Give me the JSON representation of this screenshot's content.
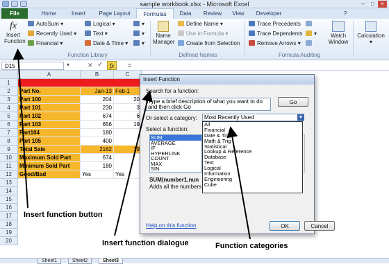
{
  "window": {
    "title": "sample workbook.xlsx - Microsoft Excel"
  },
  "tabs": [
    "File",
    "Home",
    "Insert",
    "Page Layout",
    "Formulas",
    "Data",
    "Review",
    "View",
    "Developer"
  ],
  "ribbon": {
    "insert_function": "Insert\nFunction",
    "fx": "fx",
    "library": {
      "autosum": "AutoSum",
      "recently_used": "Recently Used",
      "financial": "Financial",
      "logical": "Logical",
      "text": "Text",
      "date_time": "Date & Time",
      "group_label": "Function Library"
    },
    "defined_names": {
      "name_manager": "Name\nManager",
      "define_name": "Define Name",
      "use_in_formula": "Use in Formula",
      "create_from_selection": "Create from Selection",
      "group_label": "Defined Names"
    },
    "auditing": {
      "trace_precedents": "Trace Precedents",
      "trace_dependents": "Trace Dependents",
      "remove_arrows": "Remove Arrows",
      "watch_window": "Watch\nWindow",
      "group_label": "Formula Auditing"
    },
    "calculation": "Calculation"
  },
  "formula_bar": {
    "name_box": "D15",
    "fx": "fx",
    "equals": "="
  },
  "sheet": {
    "columns": [
      "A",
      "B",
      "C"
    ],
    "rows": [
      "1",
      "2",
      "3",
      "4",
      "5",
      "6",
      "7",
      "8",
      "9",
      "10",
      "11",
      "12",
      "13",
      "14",
      "15",
      "16",
      "17",
      "18",
      "19",
      "20"
    ],
    "part_header": "Part No.",
    "jan_header": "Jan-13",
    "feb_header": "Feb-1",
    "part_labels": [
      "Part 100",
      "Part 101",
      "Part 102",
      "Part 103",
      "Part104",
      "Part 105"
    ],
    "jan_values": [
      "204",
      "230",
      "674",
      "656",
      "180",
      "400"
    ],
    "feb_values": [
      "20",
      "3",
      "6",
      "19",
      "",
      ""
    ],
    "total_label": "Total Sale",
    "total_value": "2162",
    "total_feb": "19",
    "max_label": "Maximum Sold Part",
    "max_value": "674",
    "min_label": "Minimum Sold Part",
    "min_value": "180",
    "good_label": "Good/Bad",
    "good_b": "Yes",
    "good_c": "Yes",
    "sheet_tabs": [
      "Sheet1",
      "Sheet2",
      "Sheet3"
    ]
  },
  "dialog": {
    "title": "Insert Function",
    "search_label": "Search for a function:",
    "search_text": "Type a brief description of what you want to do and then click Go",
    "go": "Go",
    "category_label": "Or select a category:",
    "category_value": "Most Recently Used",
    "categories": [
      "All",
      "Financial",
      "Date & Time",
      "Math & Trig",
      "Statistical",
      "Lookup & Reference",
      "Database",
      "Text",
      "Logical",
      "Information",
      "Engineering",
      "Cube"
    ],
    "select_label": "Select a function:",
    "functions": [
      "SUM",
      "AVERAGE",
      "IF",
      "HYPERLINK",
      "COUNT",
      "MAX",
      "SIN"
    ],
    "syntax": "SUM(number1,nun",
    "description": "Adds all the numbers i",
    "help": "Help on this function",
    "ok": "OK",
    "cancel": "Cancel"
  },
  "callouts": {
    "insert_button": "Insert function button",
    "dialogue": "Insert function dialogue",
    "categories": "Function categories"
  },
  "colors": {
    "orange": "#f7b72c",
    "red": "#ee1c1c",
    "green_tab": "#2a6d2e",
    "selection": "#3875d7"
  }
}
